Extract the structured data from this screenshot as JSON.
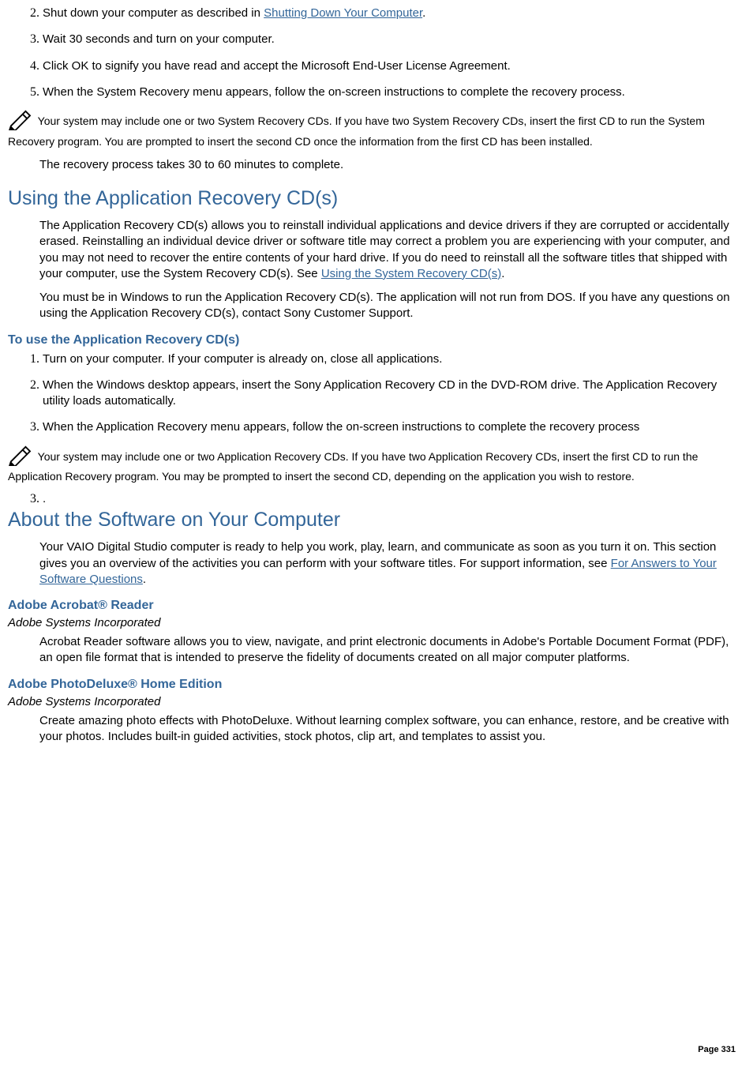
{
  "steps_top": [
    {
      "pre": "Shut down your computer as described in ",
      "link": "Shutting Down Your Computer",
      "post": "."
    },
    {
      "pre": "Wait 30 seconds and turn on your computer."
    },
    {
      "pre": "Click OK to signify you have read and accept the Microsoft End-User License Agreement."
    },
    {
      "pre": "When the System Recovery menu appears, follow the on-screen instructions to complete the recovery process."
    }
  ],
  "note1": "Your system may include one or two System Recovery CDs. If you have two System Recovery CDs, insert the first CD to run the System Recovery program. You are prompted to insert the second CD once the information from the first CD has been installed.",
  "recovery_time": "The recovery process takes 30 to 60 minutes to complete.",
  "h_app_rec": "Using the Application Recovery CD(s)",
  "app_rec_p1_pre": "The Application Recovery CD(s) allows you to reinstall individual applications and device drivers if they are corrupted or accidentally erased. Reinstalling an individual device driver or software title may correct a problem you are experiencing with your computer, and you may not need to recover the entire contents of your hard drive. If you do need to reinstall all the software titles that shipped with your computer, use the System Recovery CD(s). See ",
  "app_rec_p1_link": "Using the System Recovery CD(s)",
  "app_rec_p1_post": ".",
  "app_rec_p2": "You must be in Windows to run the Application Recovery CD(s). The application will not run from DOS. If you have any questions on using the Application Recovery CD(s), contact Sony Customer Support.",
  "h_to_use": "To use the Application Recovery CD(s)",
  "steps_app": [
    "Turn on your computer. If your computer is already on, close all applications.",
    "When the Windows desktop appears, insert the Sony Application Recovery CD in the DVD-ROM drive. The Application Recovery utility loads automatically.",
    "When the Application Recovery menu appears, follow the on-screen instructions to complete the recovery process"
  ],
  "note2": "Your system may include one or two Application Recovery CDs. If you have two Application Recovery CDs, insert the first CD to run the Application Recovery program. You may be prompted to insert the second CD, depending on the application you wish to restore.",
  "dot_item": ".",
  "h_about": "About the Software on Your Computer",
  "about_p_pre": "Your VAIO Digital Studio computer is ready to help you work, play, learn, and communicate as soon as you turn it on. This section gives you an overview of the activities you can perform with your software titles. For support information, see ",
  "about_p_link": "For Answers to Your Software Questions",
  "about_p_post": ".",
  "h_acrobat": "Adobe Acrobat® Reader",
  "acrobat_company": "Adobe Systems Incorporated",
  "acrobat_p": "Acrobat Reader software allows you to view, navigate, and print electronic documents in Adobe's Portable Document Format (PDF), an open file format that is intended to preserve the fidelity of documents created on all major computer platforms.",
  "h_photodeluxe": "Adobe PhotoDeluxe® Home Edition",
  "photodeluxe_company": "Adobe Systems Incorporated",
  "photodeluxe_p": "Create amazing photo effects with PhotoDeluxe. Without learning complex software, you can enhance, restore, and be creative with your photos. Includes built-in guided activities, stock photos, clip art, and templates to assist you.",
  "page_number": "Page 331"
}
